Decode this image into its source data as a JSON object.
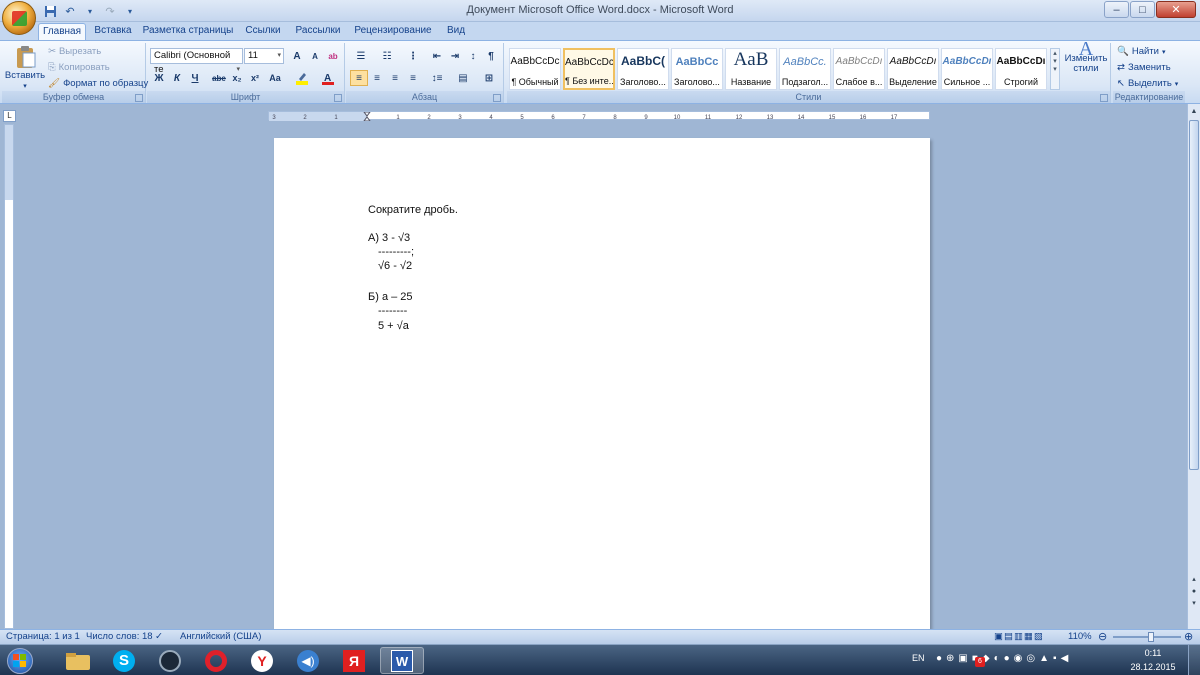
{
  "window": {
    "title": "Документ Microsoft Office Word.docx - Microsoft Word",
    "controls": [
      "–",
      "□",
      "✕"
    ]
  },
  "tabs": [
    "Главная",
    "Вставка",
    "Разметка страницы",
    "Ссылки",
    "Рассылки",
    "Рецензирование",
    "Вид"
  ],
  "active_tab": "Главная",
  "ribbon": {
    "clipboard": {
      "paste": "Вставить",
      "cut": "Вырезать",
      "copy": "Копировать",
      "format_painter": "Формат по образцу",
      "label": "Буфер обмена"
    },
    "font": {
      "name": "Calibri (Основной те",
      "size": "11",
      "bold": "Ж",
      "italic": "К",
      "underline": "Ч",
      "strike": "abe",
      "subscript": "x₂",
      "superscript": "x²",
      "case": "Aa",
      "grow": "A",
      "shrink": "A",
      "clear": "ab",
      "label": "Шрифт"
    },
    "paragraph": {
      "label": "Абзац",
      "pilcrow": "¶"
    },
    "styles": {
      "label": "Стили",
      "items": [
        {
          "sample": "AaBbCcDc",
          "name": "¶ Обычный"
        },
        {
          "sample": "AaBbCcDc",
          "name": "¶ Без инте..."
        },
        {
          "sample": "AaBbC(",
          "name": "Заголово..."
        },
        {
          "sample": "AaBbCc",
          "name": "Заголово..."
        },
        {
          "sample": "AaB",
          "name": "Название"
        },
        {
          "sample": "AaBbCc.",
          "name": "Подзагол..."
        },
        {
          "sample": "AaBbCcDı",
          "name": "Слабое в..."
        },
        {
          "sample": "AaBbCcDı",
          "name": "Выделение"
        },
        {
          "sample": "AaBbCcDı",
          "name": "Сильное ..."
        },
        {
          "sample": "AaBbCcDı",
          "name": "Строгий"
        }
      ],
      "active_index": 1,
      "change": "Изменить стили"
    },
    "editing": {
      "find": "Найти",
      "replace": "Заменить",
      "select": "Выделить",
      "label": "Редактирование"
    }
  },
  "ruler": {
    "numbers": [
      "3",
      "2",
      "1",
      "1",
      "2",
      "3",
      "4",
      "5",
      "6",
      "7",
      "8",
      "9",
      "10",
      "11",
      "12",
      "13",
      "14",
      "15",
      "16",
      "17"
    ]
  },
  "document": {
    "lines": [
      "Сократите дробь.",
      "А) 3 - √3",
      "---------;",
      "√6 - √2",
      "Б) а – 25",
      "--------",
      "5 + √а"
    ]
  },
  "status": {
    "page": "Страница: 1 из 1",
    "words": "Число слов: 18",
    "language": "Английский (США)",
    "zoom": "110%"
  },
  "taskbar": {
    "lang": "EN",
    "time": "0:11",
    "date": "28.12.2015",
    "badge": "6"
  },
  "colors": {
    "ribbon_text": "#15428b",
    "active_style_border": "#f0c060",
    "taskbar": "#1e3451"
  }
}
